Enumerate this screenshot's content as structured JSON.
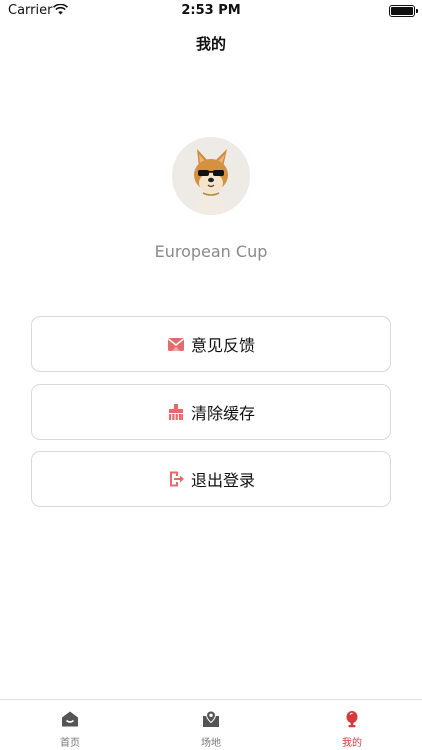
{
  "status": {
    "carrier": "Carrier",
    "time": "2:53 PM"
  },
  "nav": {
    "title": "我的"
  },
  "profile": {
    "name": "European Cup"
  },
  "menu": [
    {
      "label": "意见反馈",
      "icon": "envelope-icon"
    },
    {
      "label": "清除缓存",
      "icon": "broom-icon"
    },
    {
      "label": "退出登录",
      "icon": "logout-icon"
    }
  ],
  "tabs": [
    {
      "label": "首页",
      "icon": "home-icon",
      "active": false
    },
    {
      "label": "场地",
      "icon": "location-icon",
      "active": false
    },
    {
      "label": "我的",
      "icon": "trophy-icon",
      "active": true
    }
  ],
  "colors": {
    "accent": "#d9393b",
    "icon": "#e8696b",
    "border": "#d9d9d9"
  }
}
